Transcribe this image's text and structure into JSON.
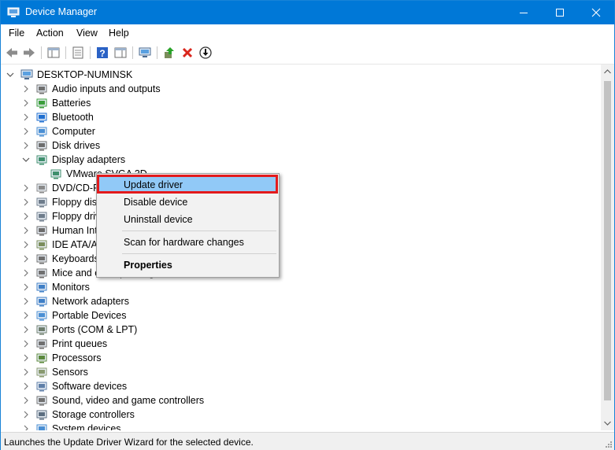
{
  "window": {
    "title": "Device Manager"
  },
  "menu": [
    "File",
    "Action",
    "View",
    "Help"
  ],
  "tree": {
    "root": "DESKTOP-NUMINSK",
    "categories": [
      {
        "label": "Audio inputs and outputs",
        "icon": "speaker-icon"
      },
      {
        "label": "Batteries",
        "icon": "battery-icon"
      },
      {
        "label": "Bluetooth",
        "icon": "bluetooth-icon"
      },
      {
        "label": "Computer",
        "icon": "computer-icon"
      },
      {
        "label": "Disk drives",
        "icon": "disk-drive-icon"
      },
      {
        "label": "Display adapters",
        "icon": "display-adapter-icon",
        "expanded": true
      },
      {
        "label": "VMware SVGA 3D",
        "icon": "display-adapter-icon",
        "child": true
      },
      {
        "label": "DVD/CD-ROM drives",
        "icon": "dvd-drive-icon"
      },
      {
        "label": "Floppy disk controllers",
        "icon": "floppy-controller-icon"
      },
      {
        "label": "Floppy drive",
        "icon": "floppy-drive-icon"
      },
      {
        "label": "Human Interface Devices",
        "icon": "hid-icon"
      },
      {
        "label": "IDE ATA/ATAPI controllers",
        "icon": "ide-controller-icon"
      },
      {
        "label": "Keyboards",
        "icon": "keyboard-icon"
      },
      {
        "label": "Mice and other pointing devices",
        "icon": "mouse-icon"
      },
      {
        "label": "Monitors",
        "icon": "monitor-icon"
      },
      {
        "label": "Network adapters",
        "icon": "network-adapter-icon"
      },
      {
        "label": "Portable Devices",
        "icon": "portable-device-icon"
      },
      {
        "label": "Ports (COM & LPT)",
        "icon": "port-icon"
      },
      {
        "label": "Print queues",
        "icon": "printer-icon"
      },
      {
        "label": "Processors",
        "icon": "processor-icon"
      },
      {
        "label": "Sensors",
        "icon": "sensor-icon"
      },
      {
        "label": "Software devices",
        "icon": "software-device-icon"
      },
      {
        "label": "Sound, video and game controllers",
        "icon": "sound-controller-icon"
      },
      {
        "label": "Storage controllers",
        "icon": "storage-controller-icon"
      },
      {
        "label": "System devices",
        "icon": "system-device-icon"
      }
    ]
  },
  "context_menu": {
    "items": [
      {
        "label": "Update driver",
        "highlighted": true
      },
      {
        "label": "Disable device"
      },
      {
        "label": "Uninstall device"
      },
      {
        "label": "Scan for hardware changes"
      },
      {
        "label": "Properties",
        "bold": true
      }
    ]
  },
  "status": "Launches the Update Driver Wizard for the selected device.",
  "colors": {
    "titlebar": "#0078d7",
    "menu_highlight": "#91c9f7",
    "callout_border": "#e31a1c"
  }
}
